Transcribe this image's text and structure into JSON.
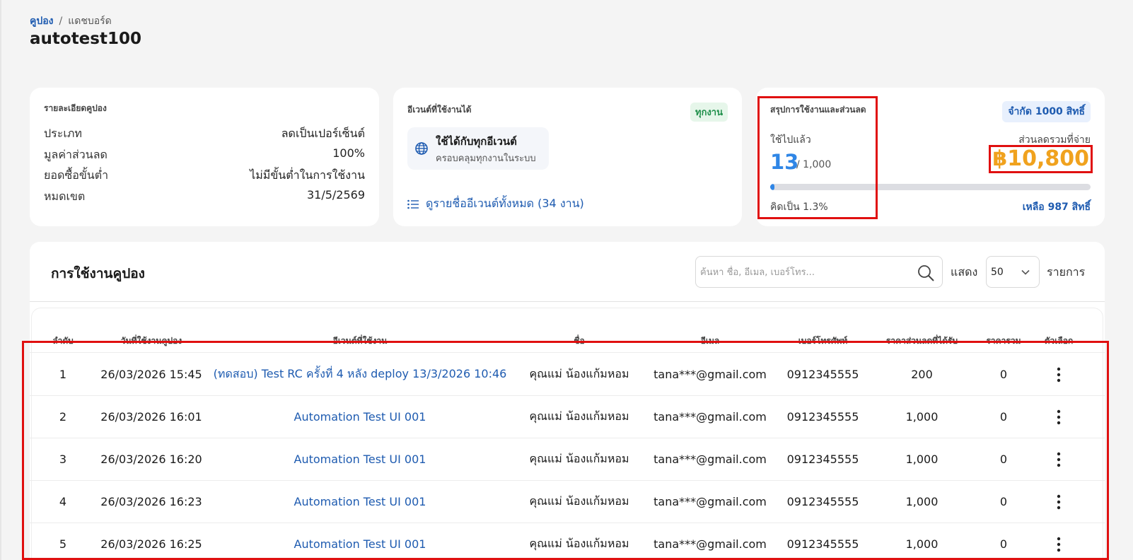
{
  "breadcrumb": {
    "root": "คูปอง",
    "separator": "/",
    "current": "แดชบอร์ด"
  },
  "page_title": "autotest100",
  "coupon_details": {
    "title": "รายละเอียดคูปอง",
    "rows": [
      {
        "label": "ประเภท",
        "value": "ลดเป็นเปอร์เซ็นต์"
      },
      {
        "label": "มูลค่าส่วนลด",
        "value": "100%"
      },
      {
        "label": "ยอดซื้อขั้นต่ำ",
        "value": "ไม่มีขั้นต่ำในการใช้งาน"
      },
      {
        "label": "หมดเขต",
        "value": "31/5/2569"
      }
    ]
  },
  "events_card": {
    "title": "อีเวนต์ที่ใช้งานได้",
    "badge": "ทุกงาน",
    "event_title": "ใช้ได้กับทุกอีเวนต์",
    "event_subtitle": "ครอบคลุมทุกงานในระบบ",
    "link_label": "ดูรายชื่ออีเวนต์ทั้งหมด (34 งาน)",
    "icons": [
      "globe-icon",
      "list-icon"
    ]
  },
  "summary_card": {
    "title": "สรุปการใช้งานและส่วนลด",
    "limit_badge": "จำกัด 1000 สิทธิ์",
    "used_label": "ใช้ไปแล้ว",
    "used_count": "13",
    "used_total": "/ 1,000",
    "discount_label": "ส่วนลดรวมที่จ่าย",
    "discount_total": "฿10,800",
    "progress_fraction": 0.013,
    "percent_text": "คิดเป็น 1.3%",
    "remaining_text": "เหลือ 987 สิทธิ์"
  },
  "usage_table": {
    "title": "การใช้งานคูปอง",
    "search_placeholder": "ค้นหา ชื่อ, อีเมล, เบอร์โทร...",
    "show_label": "แสดง",
    "page_size": "50",
    "items_label": "รายการ",
    "columns": [
      "ลำดับ",
      "วันที่ใช้งานคูปอง",
      "อีเวนต์ที่ใช้งาน",
      "ชื่อ",
      "อีเมล",
      "เบอร์โทรศัพท์",
      "ราคาส่วนลดที่ได้รับ",
      "ราคารวม",
      "ตัวเลือก"
    ],
    "rows": [
      {
        "no": "1",
        "date": "26/03/2026 15:45",
        "event": "(ทดสอบ) Test RC ครั้งที่ 4 หลัง deploy 13/3/2026 10:46",
        "name": "คุณแม่ น้องแก้มหอม",
        "email": "tana***@gmail.com",
        "phone": "0912345555",
        "discount": "200",
        "total": "0"
      },
      {
        "no": "2",
        "date": "26/03/2026 16:01",
        "event": "Automation Test UI 001",
        "name": "คุณแม่ น้องแก้มหอม",
        "email": "tana***@gmail.com",
        "phone": "0912345555",
        "discount": "1,000",
        "total": "0"
      },
      {
        "no": "3",
        "date": "26/03/2026 16:20",
        "event": "Automation Test UI 001",
        "name": "คุณแม่ น้องแก้มหอม",
        "email": "tana***@gmail.com",
        "phone": "0912345555",
        "discount": "1,000",
        "total": "0"
      },
      {
        "no": "4",
        "date": "26/03/2026 16:23",
        "event": "Automation Test UI 001",
        "name": "คุณแม่ น้องแก้มหอม",
        "email": "tana***@gmail.com",
        "phone": "0912345555",
        "discount": "1,000",
        "total": "0"
      },
      {
        "no": "5",
        "date": "26/03/2026 16:25",
        "event": "Automation Test UI 001",
        "name": "คุณแม่ น้องแก้มหอม",
        "email": "tana***@gmail.com",
        "phone": "0912345555",
        "discount": "1,000",
        "total": "0"
      }
    ]
  },
  "colors": {
    "accent_blue": "#2f86e6",
    "link_blue": "#1e5bb0",
    "discount_orange": "#f0a21e",
    "highlight_red": "#e01010",
    "badge_green": "#1e8f4a"
  }
}
